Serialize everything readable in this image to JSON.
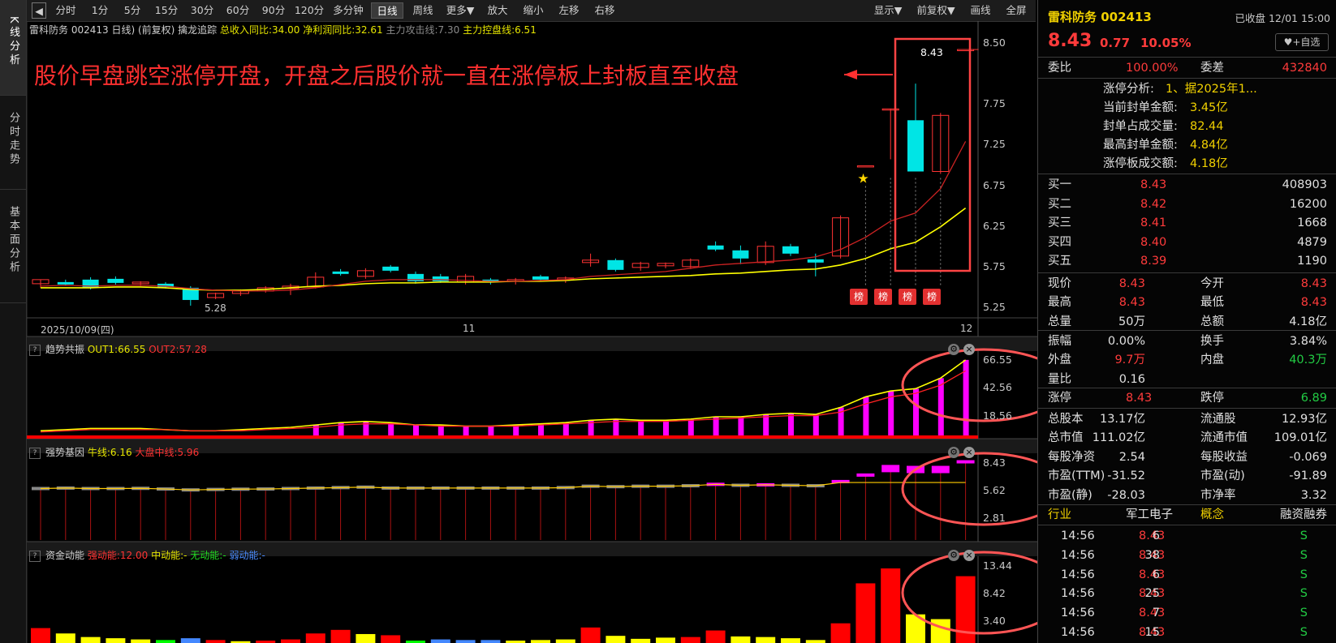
{
  "left_tabs": [
    {
      "label": "K线分析"
    },
    {
      "label": "分时走势"
    },
    {
      "label": "基本面分析"
    }
  ],
  "toolbar": {
    "back_icon": "left-arrow-icon",
    "buttons": [
      "分时",
      "1分",
      "5分",
      "15分",
      "30分",
      "60分",
      "90分",
      "120分",
      "多分钟",
      "日线",
      "周线",
      "更多▼",
      "放大",
      "缩小",
      "左移",
      "右移"
    ],
    "active": "日线",
    "right_buttons": [
      "显示▼",
      "前复权▼",
      "画线",
      "全屏"
    ]
  },
  "main_header": {
    "stock": "雷科防务 002413 日线)",
    "adj": "(前复权)",
    "indicator": "擒龙追踪",
    "rev": "总收入同比:34.00",
    "profit": "净利润同比:32.61",
    "attack": "主力攻击线:7.30",
    "control": "主力控盘线:6.51"
  },
  "annotation": "股价早盘跳空涨停开盘，开盘之后股价就一直在涨停板上封板直至收盘",
  "main_chart": {
    "price_axis": [
      "8.50",
      "7.75",
      "7.25",
      "6.75",
      "6.25",
      "5.75",
      "5.25"
    ],
    "last_price_label": "8.43",
    "low_label": "5.28",
    "date_labels": [
      "2025/10/09(四)",
      "11",
      "12"
    ],
    "badge_label": "榜"
  },
  "panels": [
    {
      "title": "趋势共振",
      "items": [
        {
          "text": "OUT1:66.55",
          "color": "yellow"
        },
        {
          "text": "OUT2:57.28",
          "color": "red"
        }
      ],
      "axis": [
        "66.55",
        "42.56",
        "18.56"
      ]
    },
    {
      "title": "强势基因",
      "items": [
        {
          "text": "牛线:6.16",
          "color": "yellow"
        },
        {
          "text": "大盘中线:5.96",
          "color": "red"
        }
      ],
      "axis": [
        "8.43",
        "5.62",
        "2.81"
      ]
    },
    {
      "title": "资金动能",
      "items": [
        {
          "text": "强动能:12.00",
          "color": "red"
        },
        {
          "text": "中动能:-",
          "color": "yellow"
        },
        {
          "text": "无动能:-",
          "color": "green"
        },
        {
          "text": "弱动能:-",
          "color": "blue"
        }
      ],
      "axis": [
        "13.44",
        "8.42",
        "3.40"
      ]
    }
  ],
  "chart_data": {
    "type": "candlestick",
    "candles": [
      {
        "o": 5.55,
        "h": 5.6,
        "l": 5.5,
        "c": 5.6
      },
      {
        "o": 5.57,
        "h": 5.6,
        "l": 5.53,
        "c": 5.54
      },
      {
        "o": 5.6,
        "h": 5.63,
        "l": 5.48,
        "c": 5.5
      },
      {
        "o": 5.61,
        "h": 5.64,
        "l": 5.54,
        "c": 5.56
      },
      {
        "o": 5.55,
        "h": 5.58,
        "l": 5.52,
        "c": 5.57
      },
      {
        "o": 5.55,
        "h": 5.57,
        "l": 5.49,
        "c": 5.51
      },
      {
        "o": 5.5,
        "h": 5.52,
        "l": 5.28,
        "c": 5.35
      },
      {
        "o": 5.38,
        "h": 5.44,
        "l": 5.36,
        "c": 5.43
      },
      {
        "o": 5.43,
        "h": 5.48,
        "l": 5.4,
        "c": 5.46
      },
      {
        "o": 5.46,
        "h": 5.52,
        "l": 5.44,
        "c": 5.5
      },
      {
        "o": 5.49,
        "h": 5.55,
        "l": 5.41,
        "c": 5.52
      },
      {
        "o": 5.51,
        "h": 5.69,
        "l": 5.49,
        "c": 5.63
      },
      {
        "o": 5.7,
        "h": 5.73,
        "l": 5.65,
        "c": 5.67
      },
      {
        "o": 5.64,
        "h": 5.74,
        "l": 5.61,
        "c": 5.71
      },
      {
        "o": 5.76,
        "h": 5.78,
        "l": 5.69,
        "c": 5.71
      },
      {
        "o": 5.67,
        "h": 5.7,
        "l": 5.55,
        "c": 5.58
      },
      {
        "o": 5.64,
        "h": 5.67,
        "l": 5.56,
        "c": 5.58
      },
      {
        "o": 5.57,
        "h": 5.67,
        "l": 5.54,
        "c": 5.64
      },
      {
        "o": 5.6,
        "h": 5.62,
        "l": 5.54,
        "c": 5.57
      },
      {
        "o": 5.58,
        "h": 5.62,
        "l": 5.54,
        "c": 5.6
      },
      {
        "o": 5.64,
        "h": 5.66,
        "l": 5.58,
        "c": 5.6
      },
      {
        "o": 5.6,
        "h": 5.64,
        "l": 5.56,
        "c": 5.62
      },
      {
        "o": 5.81,
        "h": 5.92,
        "l": 5.76,
        "c": 5.84
      },
      {
        "o": 5.84,
        "h": 5.86,
        "l": 5.7,
        "c": 5.72
      },
      {
        "o": 5.75,
        "h": 5.82,
        "l": 5.71,
        "c": 5.8
      },
      {
        "o": 5.77,
        "h": 5.81,
        "l": 5.74,
        "c": 5.8
      },
      {
        "o": 5.76,
        "h": 5.86,
        "l": 5.73,
        "c": 5.84
      },
      {
        "o": 6.02,
        "h": 6.07,
        "l": 5.95,
        "c": 5.97
      },
      {
        "o": 5.96,
        "h": 6.02,
        "l": 5.79,
        "c": 5.86
      },
      {
        "o": 5.81,
        "h": 6.07,
        "l": 5.78,
        "c": 6.01
      },
      {
        "o": 6.01,
        "h": 6.04,
        "l": 5.89,
        "c": 5.92
      },
      {
        "o": 5.85,
        "h": 5.92,
        "l": 5.64,
        "c": 5.81
      },
      {
        "o": 5.89,
        "h": 6.39,
        "l": 5.86,
        "c": 6.36
      },
      {
        "o": 7.0,
        "h": 7.0,
        "l": 7.0,
        "c": 7.0
      },
      {
        "o": 7.7,
        "h": 7.7,
        "l": 7.08,
        "c": 7.7
      },
      {
        "o": 7.56,
        "h": 8.01,
        "l": 6.93,
        "c": 6.93
      },
      {
        "o": 6.93,
        "h": 7.65,
        "l": 6.9,
        "c": 7.62
      },
      {
        "o": 8.43,
        "h": 8.43,
        "l": 8.43,
        "c": 8.43
      }
    ],
    "ma_yellow": [
      5.5,
      5.5,
      5.5,
      5.51,
      5.51,
      5.5,
      5.48,
      5.47,
      5.47,
      5.48,
      5.5,
      5.52,
      5.53,
      5.55,
      5.56,
      5.56,
      5.57,
      5.57,
      5.57,
      5.58,
      5.58,
      5.59,
      5.61,
      5.62,
      5.63,
      5.64,
      5.65,
      5.67,
      5.68,
      5.7,
      5.72,
      5.73,
      5.78,
      5.86,
      5.98,
      6.06,
      6.25,
      6.48
    ],
    "ma_red": [
      5.52,
      5.53,
      5.52,
      5.53,
      5.53,
      5.52,
      5.49,
      5.47,
      5.46,
      5.46,
      5.47,
      5.5,
      5.54,
      5.58,
      5.6,
      5.6,
      5.6,
      5.59,
      5.58,
      5.58,
      5.59,
      5.6,
      5.64,
      5.66,
      5.68,
      5.7,
      5.74,
      5.78,
      5.8,
      5.82,
      5.84,
      5.88,
      5.97,
      6.12,
      6.32,
      6.42,
      6.72,
      7.3
    ],
    "ylim": [
      5.15,
      8.62
    ],
    "price_ticks": [
      8.5,
      7.75,
      7.25,
      6.75,
      6.25,
      5.75,
      5.25
    ],
    "trend_out1": [
      6,
      7,
      8,
      8,
      8,
      7,
      6,
      6,
      7,
      8,
      9,
      11,
      13,
      14,
      13,
      11,
      11,
      10,
      10,
      11,
      12,
      13,
      15,
      16,
      15,
      15,
      16,
      18,
      18,
      20,
      21,
      20,
      26,
      35,
      40,
      42,
      51,
      66.55
    ],
    "trend_out2": [
      5,
      6,
      7,
      7,
      7,
      7,
      6,
      6,
      6,
      7,
      8,
      9,
      11,
      12,
      12,
      11,
      10,
      10,
      10,
      10,
      11,
      12,
      13,
      14,
      14,
      14,
      15,
      16,
      17,
      18,
      19,
      19,
      22,
      29,
      35,
      38,
      45,
      57.28
    ],
    "trend_ylim": [
      0,
      72
    ],
    "strength_values": [
      5.55,
      5.6,
      5.55,
      5.55,
      5.57,
      5.5,
      5.4,
      5.45,
      5.48,
      5.5,
      5.55,
      5.6,
      5.65,
      5.7,
      5.6,
      5.6,
      5.6,
      5.6,
      5.6,
      5.6,
      5.6,
      5.65,
      5.8,
      5.75,
      5.8,
      5.8,
      5.85,
      6.0,
      5.9,
      5.95,
      5.9,
      5.85,
      6.3,
      7.0,
      7.7,
      7.6,
      7.6,
      8.43
    ],
    "strength_ylim": [
      0,
      9.0
    ],
    "fund_values": [
      2.5,
      1.6,
      1.0,
      0.8,
      0.6,
      0.5,
      0.8,
      0.5,
      0.3,
      0.4,
      0.6,
      1.6,
      2.2,
      1.5,
      1.3,
      0.4,
      0.6,
      0.5,
      0.5,
      0.4,
      0.5,
      0.6,
      2.6,
      1.2,
      0.7,
      0.9,
      1.0,
      2.1,
      1.1,
      1.0,
      0.8,
      0.5,
      3.3,
      10.0,
      12.5,
      4.8,
      4.0,
      11.2
    ],
    "fund_colors": [
      "#ff0000",
      "#ffff00",
      "#ffff00",
      "#ffff00",
      "#ffff00",
      "#00ff00",
      "#4488ff",
      "#ff0000",
      "#ffff00",
      "#ff0000",
      "#ff0000",
      "#ff0000",
      "#ff0000",
      "#ffff00",
      "#ff0000",
      "#00ff00",
      "#4488ff",
      "#4488ff",
      "#4488ff",
      "#ffff00",
      "#ffff00",
      "#ffff00",
      "#ff0000",
      "#ffff00",
      "#ffff00",
      "#ffff00",
      "#ff0000",
      "#ff0000",
      "#ffff00",
      "#ffff00",
      "#ffff00",
      "#ffff00",
      "#ff0000",
      "#ff0000",
      "#ff0000",
      "#ffff00",
      "#ffff00",
      "#ff0000"
    ],
    "fund_ylim": [
      0,
      14
    ]
  },
  "quote": {
    "name": "雷科防务 002413",
    "status": "已收盘 12/01 15:00",
    "price": "8.43",
    "change": "0.77",
    "pct": "10.05%",
    "add_btn": "+自选",
    "webi_label": "委比",
    "webi": "100.00%",
    "wecha_label": "委差",
    "wecha": "432840",
    "limit_info": [
      {
        "k": "涨停分析:",
        "v": "1、据2025年1..."
      },
      {
        "k": "当前封单金额:",
        "v": "3.45亿"
      },
      {
        "k": "封单占成交量:",
        "v": "82.44"
      },
      {
        "k": "最高封单金额:",
        "v": "4.84亿"
      },
      {
        "k": "涨停板成交额:",
        "v": "4.18亿"
      }
    ],
    "bids": [
      {
        "k": "买一",
        "p": "8.43",
        "v": "408903"
      },
      {
        "k": "买二",
        "p": "8.42",
        "v": "16200"
      },
      {
        "k": "买三",
        "p": "8.41",
        "v": "1668"
      },
      {
        "k": "买四",
        "p": "8.40",
        "v": "4879"
      },
      {
        "k": "买五",
        "p": "8.39",
        "v": "1190"
      }
    ],
    "stats1": [
      {
        "k1": "现价",
        "v1": "8.43",
        "c1": "red",
        "k2": "今开",
        "v2": "8.43",
        "c2": "red"
      },
      {
        "k1": "最高",
        "v1": "8.43",
        "c1": "red",
        "k2": "最低",
        "v2": "8.43",
        "c2": "red"
      },
      {
        "k1": "总量",
        "v1": "50万",
        "c1": "white",
        "k2": "总额",
        "v2": "4.18亿",
        "c2": "white"
      }
    ],
    "stats2": [
      {
        "k1": "振幅",
        "v1": "0.00%",
        "c1": "white",
        "k2": "换手",
        "v2": "3.84%",
        "c2": "white"
      },
      {
        "k1": "外盘",
        "v1": "9.7万",
        "c1": "red",
        "k2": "内盘",
        "v2": "40.3万",
        "c2": "green"
      },
      {
        "k1": "量比",
        "v1": "0.16",
        "c1": "white",
        "k2": "",
        "v2": "",
        "c2": "white"
      }
    ],
    "limits": {
      "k1": "涨停",
      "v1": "8.43",
      "k2": "跌停",
      "v2": "6.89"
    },
    "stats3": [
      {
        "k1": "总股本",
        "v1": "13.17亿",
        "k2": "流通股",
        "v2": "12.93亿"
      },
      {
        "k1": "总市值",
        "v1": "111.02亿",
        "k2": "流通市值",
        "v2": "109.01亿"
      },
      {
        "k1": "每股净资",
        "v1": "2.54",
        "k2": "每股收益",
        "v2": "-0.069"
      },
      {
        "k1": "市盈(TTM)",
        "v1": "-31.52",
        "k2": "市盈(动)",
        "v2": "-91.89"
      },
      {
        "k1": "市盈(静)",
        "v1": "-28.03",
        "k2": "市净率",
        "v2": "3.32"
      }
    ],
    "industry": {
      "k1": "行业",
      "v1": "军工电子",
      "k2": "概念",
      "v2": "融资融券"
    },
    "ticks": [
      {
        "t": "14:56",
        "p": "8.43",
        "v": "6",
        "d": "S"
      },
      {
        "t": "14:56",
        "p": "8.43",
        "v": "38",
        "d": "S"
      },
      {
        "t": "14:56",
        "p": "8.43",
        "v": "6",
        "d": "S"
      },
      {
        "t": "14:56",
        "p": "8.43",
        "v": "25",
        "d": "S"
      },
      {
        "t": "14:56",
        "p": "8.43",
        "v": "7",
        "d": "S"
      },
      {
        "t": "14:56",
        "p": "8.43",
        "v": "15",
        "d": "S"
      }
    ]
  }
}
